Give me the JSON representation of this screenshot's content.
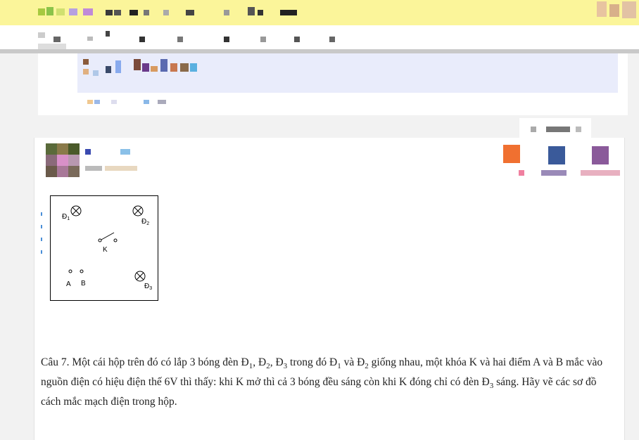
{
  "colors": {
    "topbar_bg": "#fbf59a",
    "card_bg": "#ffffff",
    "page_bg": "#f2f2f2",
    "highlight_bg": "#e9ecfb",
    "text": "#222222"
  },
  "question": {
    "number": "Câu 7.",
    "part1": " Một cái hộp trên đó có lắp 3 bóng đèn Đ",
    "sub1": "1",
    "part2": ", Đ",
    "sub2": "2",
    "part3": ", Đ",
    "sub3": "3",
    "part4": " trong đó Đ",
    "sub4": "1",
    "part5": " và Đ",
    "sub5": "2",
    "part6": " giống nhau, một khóa K và hai điểm A và B mắc vào nguồn điện có hiệu điện thế 6V thì thấy: khi K mở thì cả 3 bóng đều sáng còn khi K đóng  chỉ có đèn Đ",
    "sub6": "3",
    "part7": " sáng. Hãy vẽ các sơ đồ cách mắc mạch điện trong hộp."
  },
  "figure": {
    "lamp1_label": "Đ",
    "lamp1_sub": "1",
    "lamp2_label": "Đ",
    "lamp2_sub": "2",
    "lamp3_label": "Đ",
    "lamp3_sub": "3",
    "switch_label": "K",
    "point_a_label": "A",
    "point_b_label": "B"
  }
}
